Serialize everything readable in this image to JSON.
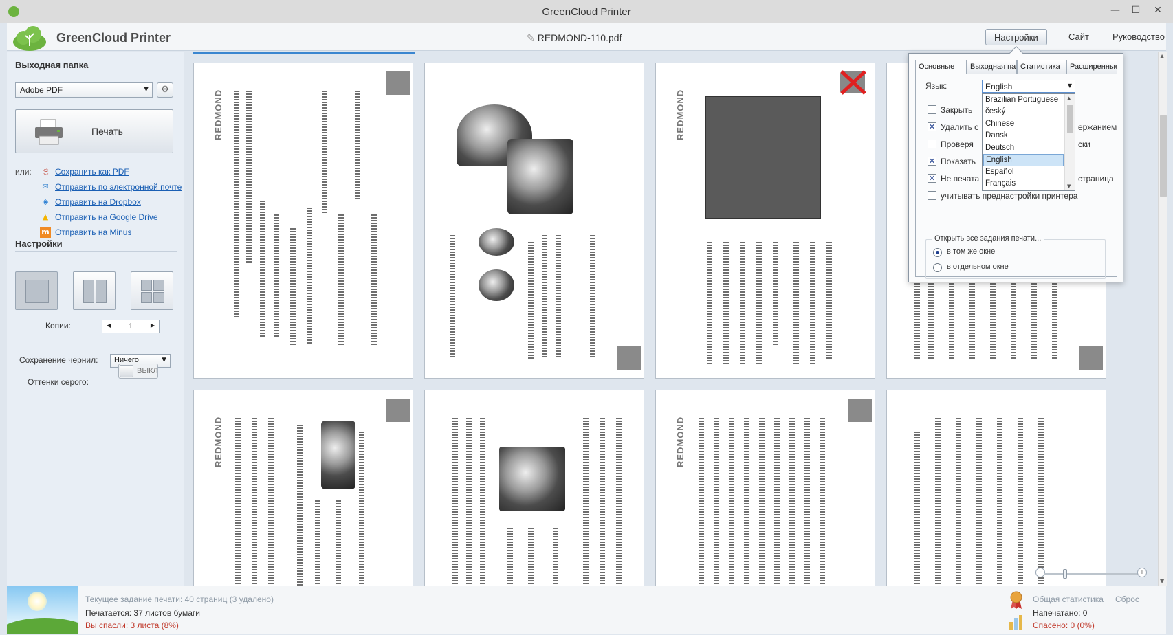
{
  "window": {
    "title": "GreenCloud Printer"
  },
  "header": {
    "app_name": "GreenCloud Printer",
    "document_name": "REDMOND-110.pdf",
    "nav": [
      "Настройки",
      "Сайт",
      "Руководство"
    ]
  },
  "left": {
    "output_folder_title": "Выходная папка",
    "output_selected": "Adobe PDF",
    "print_label": "Печать",
    "or_label": "или:",
    "links": [
      {
        "label": "Сохранить как PDF",
        "icon": "pdf-icon"
      },
      {
        "label": "Отправить по электронной почте",
        "icon": "email-icon"
      },
      {
        "label": "Отправить на Dropbox",
        "icon": "dropbox-icon"
      },
      {
        "label": "Отправить на Google Drive",
        "icon": "google-drive-icon"
      },
      {
        "label": "Отправить на Minus",
        "icon": "minus-icon"
      }
    ],
    "settings_title": "Настройки",
    "copies_label": "Копии:",
    "copies_value": "1",
    "ink_label": "Сохранение чернил:",
    "ink_value": "Ничего",
    "grayscale_label": "Оттенки серого:",
    "grayscale_state": "ВЫКЛ"
  },
  "pages": {
    "brand": "REDMOND"
  },
  "settings_popup": {
    "tabs": [
      "Основные",
      "Выходная папка",
      "Статистика",
      "Расширенные"
    ],
    "language_label": "Язык:",
    "language_selected": "English",
    "languages": [
      "Brazilian Portuguese",
      "český",
      "Chinese",
      "Dansk",
      "Deutsch",
      "English",
      "Español",
      "Français"
    ],
    "options": [
      {
        "prefix": "Закрыть",
        "suffix": "",
        "checked": false
      },
      {
        "prefix": "Удалить с",
        "suffix": "ержанием",
        "checked": true
      },
      {
        "prefix": "Проверя",
        "suffix": "ски",
        "checked": false
      },
      {
        "prefix": "Показать",
        "suffix": "",
        "checked": true
      },
      {
        "prefix": "Не печата",
        "suffix": "страница",
        "checked": true
      },
      {
        "prefix": "учитывать преднастройки принтера",
        "suffix": "",
        "checked": false
      }
    ],
    "open_group": "Открыть все задания печати...",
    "radio_same": "в том же окне",
    "radio_new": "в отдельном окне",
    "radio_selected": "same"
  },
  "status": {
    "current_job": "Текущее задание печати: 40 страниц (3 удалено)",
    "printing": "Печатается: 37 листов бумаги",
    "saved": "Вы спасли: 3 листа (8%)",
    "stats_title": "Общая статистика",
    "reset": "Сброс",
    "printed": "Напечатано: 0",
    "saved_total": "Спасено: 0 (0%)"
  },
  "colors": {
    "accent": "#3a86d0",
    "brand_green": "#6cb33f",
    "saved_red": "#c0392b"
  }
}
